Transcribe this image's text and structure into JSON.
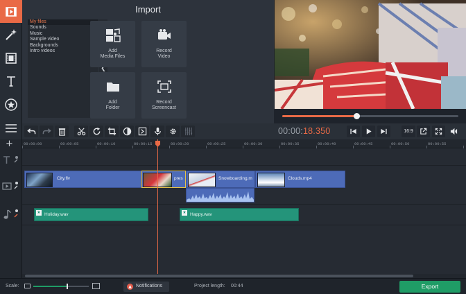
{
  "import": {
    "title": "Import",
    "tree": [
      "My files",
      "Sounds",
      "Music",
      "Sample video",
      "Backgrounds",
      "Intro videos"
    ],
    "buttons": {
      "add_media_line1": "Add",
      "add_media_line2": "Media Files",
      "record_video_line1": "Record",
      "record_video_line2": "Video",
      "add_folder_line1": "Add",
      "add_folder_line2": "Folder",
      "record_screencast_line1": "Record",
      "record_screencast_line2": "Screencast"
    }
  },
  "player": {
    "timecode_main": "00:00:",
    "timecode_accent": "18.350",
    "aspect_ratio": "16:9",
    "scrub_progress": 0.42
  },
  "timeline": {
    "ruler": [
      "00:00:00",
      "00:00:05",
      "00:00:10",
      "00:00:15",
      "00:00:20",
      "00:00:25",
      "00:00:30",
      "00:00:35",
      "00:00:40",
      "00:00:45",
      "00:00:50",
      "00:00:55"
    ],
    "video_clips": [
      "City.flv",
      "pres",
      "Snowboarding.m",
      "Clouds.mp4"
    ],
    "audio_clips": [
      "Holiday.wav",
      "Happy.wav"
    ]
  },
  "status": {
    "scale_label": "Scale:",
    "notifications_label": "Notifications",
    "project_length_label": "Project length:",
    "project_length_value": "00:44",
    "export_label": "Export"
  },
  "colors": {
    "accent": "#e96a46",
    "export": "#1f9c66",
    "video_clip": "#4d6bb8",
    "audio_clip": "#24947a"
  },
  "icons": [
    "video-import-icon",
    "magic-wand-icon",
    "film-strip-icon",
    "text-icon",
    "star-icon",
    "menu-icon",
    "undo-icon",
    "redo-icon",
    "trash-icon",
    "scissors-icon",
    "rotate-icon",
    "crop-icon",
    "color-icon",
    "transition-icon",
    "microphone-icon",
    "gear-icon",
    "equalizer-icon",
    "skip-back-icon",
    "play-icon",
    "skip-forward-icon",
    "detach-icon",
    "fullscreen-icon",
    "volume-icon"
  ]
}
